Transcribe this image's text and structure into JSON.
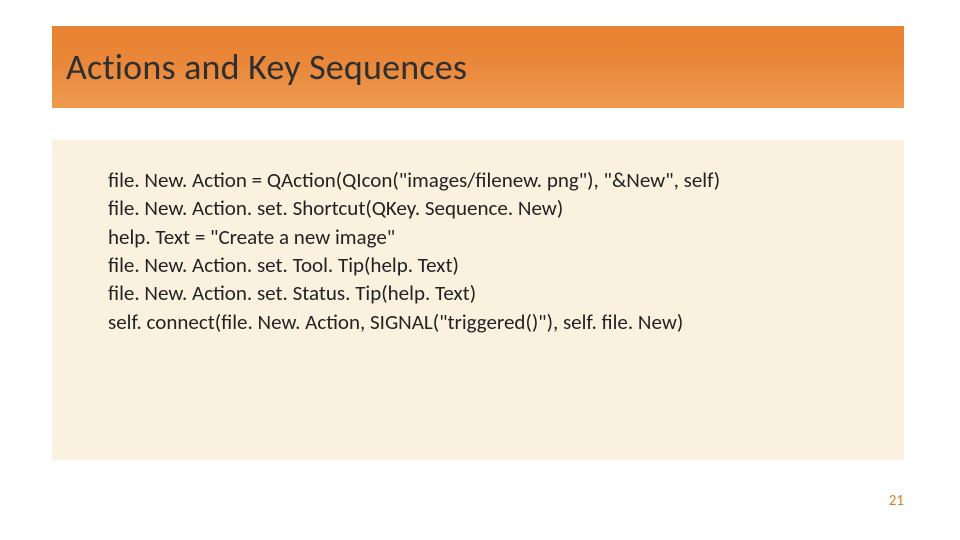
{
  "title": "Actions and Key Sequences",
  "code_lines": [
    "file. New. Action = QAction(QIcon(\"images/filenew. png\"), \"&New\", self)",
    "file. New. Action. set. Shortcut(QKey. Sequence. New)",
    "help. Text = \"Create a new image\"",
    "file. New. Action. set. Tool. Tip(help. Text)",
    "file. New. Action. set. Status. Tip(help. Text)",
    "self. connect(file. New. Action, SIGNAL(\"triggered()\"), self. file. New)"
  ],
  "page_number": "21"
}
